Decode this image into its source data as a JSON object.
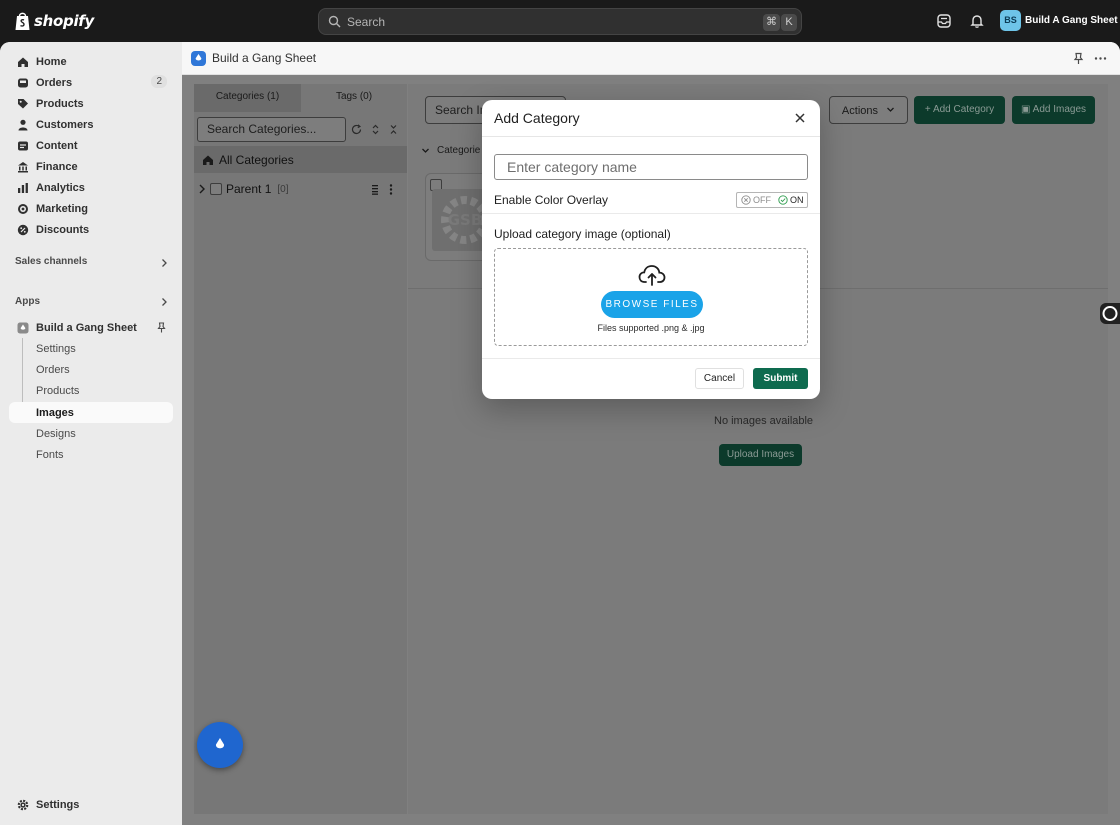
{
  "topbar": {
    "logo_text": "shopify",
    "search_placeholder": "Search",
    "shortcut_keys": [
      "⌘",
      "K"
    ],
    "store_initials": "BS",
    "store_name": "Build A Gang Sheet"
  },
  "sidebar": {
    "items": [
      {
        "label": "Home",
        "icon": "home-icon"
      },
      {
        "label": "Orders",
        "icon": "orders-icon",
        "badge": "2"
      },
      {
        "label": "Products",
        "icon": "tag-icon"
      },
      {
        "label": "Customers",
        "icon": "person-icon"
      },
      {
        "label": "Content",
        "icon": "content-icon"
      },
      {
        "label": "Finance",
        "icon": "bank-icon"
      },
      {
        "label": "Analytics",
        "icon": "chart-icon"
      },
      {
        "label": "Marketing",
        "icon": "target-icon"
      },
      {
        "label": "Discounts",
        "icon": "discount-icon"
      }
    ],
    "sales_channels_label": "Sales channels",
    "apps_label": "Apps",
    "app_name": "Build a Gang Sheet",
    "app_subitems": [
      "Settings",
      "Orders",
      "Products",
      "Images",
      "Designs",
      "Fonts"
    ],
    "active_subitem": "Images",
    "settings_label": "Settings"
  },
  "app": {
    "title": "Build a Gang Sheet",
    "tabs": [
      "Categories (1)",
      "Tags (0)"
    ],
    "category_search_placeholder": "Search Categories...",
    "all_categories_label": "All Categories",
    "parent_label": "Parent 1",
    "parent_count": "[0]",
    "image_search_placeholder": "Search Im",
    "actions_label": "Actions",
    "add_category_label": "Add Category",
    "add_images_label": "Add Images",
    "categories_header": "Categorie",
    "thumb_text": "GSB",
    "no_images_text": "No images available",
    "upload_images_label": "Upload Images"
  },
  "modal": {
    "title": "Add Category",
    "name_placeholder": "Enter category name",
    "overlay_label": "Enable Color Overlay",
    "toggle_off": "OFF",
    "toggle_on": "ON",
    "upload_label": "Upload category image (optional)",
    "browse_label": "BROWSE FILES",
    "files_note": "Files supported .png & .jpg",
    "cancel_label": "Cancel",
    "submit_label": "Submit"
  },
  "colors": {
    "browse_blue": "#1aa3e8",
    "submit_green": "#0e6b4f",
    "app_blue": "#2f77d8"
  }
}
